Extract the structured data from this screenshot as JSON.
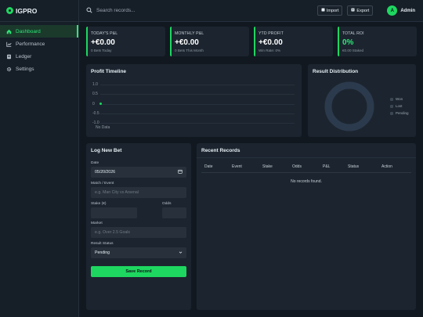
{
  "brand": {
    "name": "IGPRO"
  },
  "sidebar": {
    "items": [
      {
        "label": "Dashboard",
        "icon": "home-icon",
        "active": true
      },
      {
        "label": "Performance",
        "icon": "trend-icon",
        "active": false
      },
      {
        "label": "Ledger",
        "icon": "ledger-icon",
        "active": false
      },
      {
        "label": "Settings",
        "icon": "gear-icon",
        "active": false
      }
    ]
  },
  "topbar": {
    "search_placeholder": "Search records...",
    "import_label": "Import",
    "export_label": "Export",
    "avatar_initial": "A",
    "user_name": "Admin"
  },
  "stats": [
    {
      "label": "TODAY'S P&L",
      "value": "+€0.00",
      "sub": "0 Bets Today"
    },
    {
      "label": "MONTHLY P&L",
      "value": "+€0.00",
      "sub": "0 Bets This Month"
    },
    {
      "label": "YTD PROFIT",
      "value": "+€0.00",
      "sub": "Win Rate: 0%"
    },
    {
      "label": "TOTAL ROI",
      "value": "0%",
      "sub": "€0.00 Staked"
    }
  ],
  "timeline": {
    "title": "Profit Timeline",
    "chart_data": {
      "type": "line",
      "x": [
        "No Data"
      ],
      "series": [
        {
          "values": [
            0
          ]
        }
      ],
      "ylim": [
        -1,
        1
      ],
      "yticks": [
        "1.0",
        "0.5",
        "0",
        "-0.5",
        "-1.0"
      ],
      "color": "#1ed760"
    }
  },
  "distribution": {
    "title": "Result Distribution",
    "legend": [
      "Won",
      "Lost",
      "Pending"
    ]
  },
  "form": {
    "title": "Log New Bet",
    "date_label": "Date",
    "date_value": "05/20/2026",
    "match_label": "Match / Event",
    "match_placeholder": "e.g. Man City vs Arsenal",
    "stake_label": "Stake (€)",
    "odds_label": "Odds",
    "market_label": "Market",
    "market_placeholder": "e.g. Over 2.5 Goals",
    "status_label": "Result Status",
    "status_value": "Pending",
    "save_label": "Save Record"
  },
  "records": {
    "title": "Recent Records",
    "columns": [
      "Date",
      "Event",
      "Stake",
      "Odds",
      "P&L",
      "Status",
      "Action"
    ],
    "empty_text": "No records found."
  },
  "colors": {
    "accent": "#1ed760",
    "background": "#111820",
    "panel": "#1c252f"
  }
}
